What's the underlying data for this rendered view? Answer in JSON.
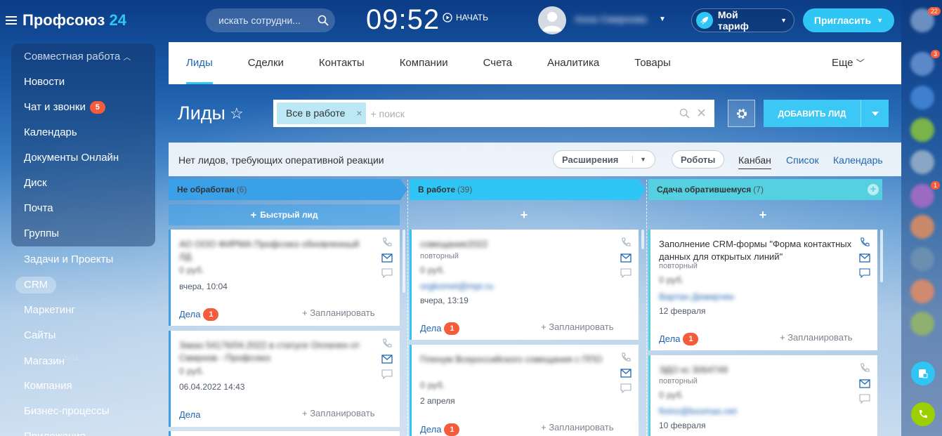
{
  "app": {
    "brand": "Профсоюз",
    "brand_num": "24"
  },
  "header": {
    "search_placeholder": "искать сотрудни...",
    "clock": "09:52",
    "start_label": "НАЧАТЬ",
    "user_name": "Анна Смирнова",
    "tariff_label": "Мой тариф",
    "invite_label": "Пригласить"
  },
  "menu": {
    "group_title": "Совместная работа",
    "items": [
      {
        "label": "Новости"
      },
      {
        "label": "Чат и звонки",
        "badge": "5"
      },
      {
        "label": "Календарь"
      },
      {
        "label": "Документы Онлайн"
      },
      {
        "label": "Диск"
      },
      {
        "label": "Почта"
      },
      {
        "label": "Группы"
      },
      {
        "label": "Задачи и Проекты"
      },
      {
        "label": "CRM"
      },
      {
        "label": "Маркетинг"
      },
      {
        "label": "Сайты"
      },
      {
        "label": "Магазин",
        "sup": "beta"
      },
      {
        "label": "Компания"
      },
      {
        "label": "Бизнес-процессы"
      },
      {
        "label": "Приложения"
      }
    ]
  },
  "rail": {
    "badges": [
      "22",
      "3",
      "1"
    ]
  },
  "crm_tabs": [
    "Лиды",
    "Сделки",
    "Контакты",
    "Компании",
    "Счета",
    "Аналитика",
    "Товары"
  ],
  "crm_more": "Еще",
  "page": {
    "title": "Лиды",
    "filter_tag": "Все в работе",
    "filter_placeholder": "+ поиск",
    "add_button": "ДОБАВИТЬ ЛИД",
    "notice": "Нет лидов, требующих оперативной реакции",
    "extensions": "Расширения",
    "robots": "Роботы",
    "views": [
      "Канбан",
      "Список",
      "Календарь"
    ]
  },
  "columns": [
    {
      "name": "Не обработан",
      "count": "(6)",
      "color": "#3aa0e8",
      "quick": "Быстрый лид"
    },
    {
      "name": "В работе",
      "count": "(39)",
      "color": "#2fc6f6",
      "quick": ""
    },
    {
      "name": "Сдача обратившемуся",
      "count": "(7)",
      "color": "#55d0e0",
      "quick": ""
    }
  ],
  "cards": {
    "c1": {
      "title": "АО ООО ФИРМА Профсоюз обновленный ЛД",
      "price": "0 руб.",
      "date": "вчера, 10:04",
      "deals": "Дела",
      "deals_badge": "1",
      "plan": "+ Запланировать"
    },
    "c2": {
      "title": "Заказ 54176/04.2022 в статусе Оплачен от Смирнов - Профсоюз",
      "price": "0 руб.",
      "date": "06.04.2022 14:43",
      "deals": "Дела",
      "plan": "+ Запланировать"
    },
    "c3": {
      "title": "совещание2022",
      "sub": "повторный",
      "price": "0 руб.",
      "link": "orgkomet@mpr.ru",
      "date": "вчера, 13:19",
      "deals": "Дела",
      "deals_badge": "1",
      "plan": "+ Запланировать"
    },
    "c4": {
      "title": "Пленум Всероссийского совещания с ППО",
      "price": "0 руб.",
      "date": "2 апреля",
      "deals": "Дела",
      "deals_badge": "1",
      "plan": "+ Запланировать"
    },
    "c5": {
      "title": "Заполнение CRM-формы \"Форма контактных данных для открытых линий\"",
      "sub": "повторный",
      "price": "0 руб.",
      "link": "Вартан Демирчян",
      "date": "12 февраля",
      "deals": "Дела",
      "deals_badge": "1",
      "plan": "+ Запланировать"
    },
    "c6": {
      "title": "ЭДО кс 3064749",
      "sub": "повторный",
      "price": "0 руб.",
      "link": "fivino@bxomas.net",
      "date": "10 февраля"
    }
  }
}
